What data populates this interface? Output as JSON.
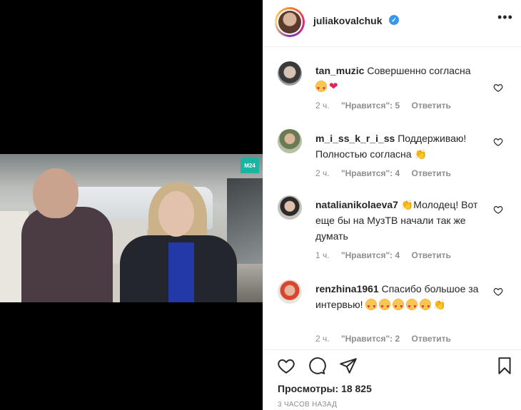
{
  "post": {
    "username": "juliakovalchuk",
    "verified_mark": "✓",
    "more_label": "•••",
    "video_logo": "M24",
    "views_label": "Просмотры:",
    "views_count": "18 825",
    "posted_time": "3 ЧАСОВ НАЗАД"
  },
  "comments": [
    {
      "user": "tan_muzic",
      "text": "Совершенно согласна",
      "time": "2 ч.",
      "likes": "\"Нравится\": 5",
      "reply": "Ответить",
      "emoji": [
        "love-face",
        "red-heart"
      ]
    },
    {
      "user": "m_i_ss_k_r_i_ss",
      "text": "Поддерживаю! Полностью согласна",
      "time": "2 ч.",
      "likes": "\"Нравится\": 4",
      "reply": "Ответить",
      "emoji": [
        "clapping-hands"
      ]
    },
    {
      "user": "natalianikolaeva7",
      "text": "Молодец! Вот еще бы на МузТВ начали так же думать",
      "time": "1 ч.",
      "likes": "\"Нравится\": 4",
      "reply": "Ответить",
      "emoji": [
        "clapping-hands"
      ]
    },
    {
      "user": "renzhina1961",
      "text": "Спасибо большое за интервью!",
      "time": "2 ч.",
      "likes": "\"Нравится\": 2",
      "reply": "Ответить",
      "emoji": [
        "heart-eyes",
        "heart-eyes",
        "heart-eyes",
        "heart-eyes",
        "heart-eyes",
        "clapping-hands"
      ]
    }
  ],
  "icons": [
    "more-icon",
    "heart-icon",
    "comment-icon",
    "share-icon",
    "bookmark-icon",
    "verified-icon"
  ],
  "colors": {
    "verified": "#3897f0",
    "meta": "#8e8e8e",
    "text": "#262626",
    "logo": "#16b6a3"
  }
}
